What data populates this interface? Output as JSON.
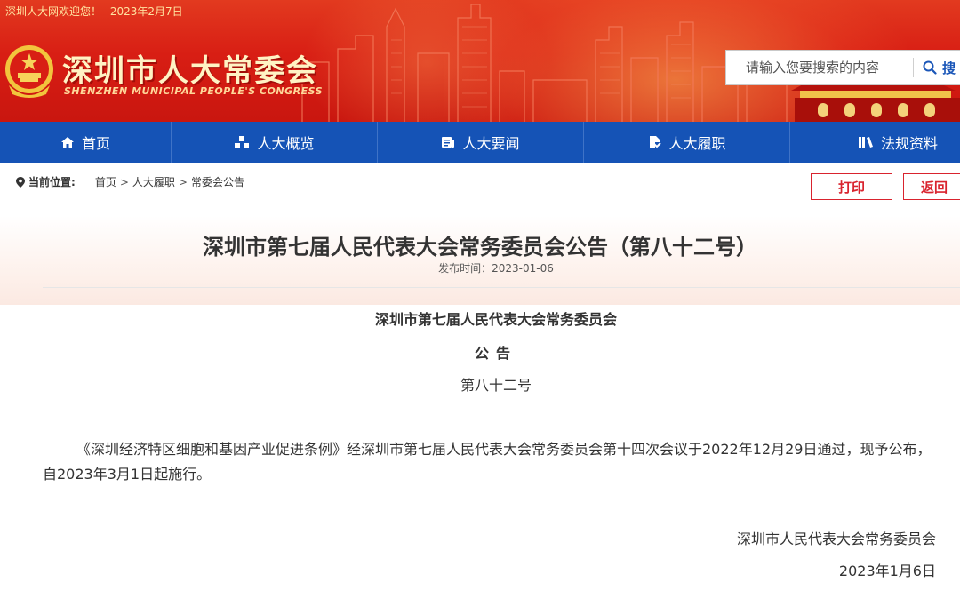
{
  "topbar": {
    "welcome": "深圳人大网欢迎您！",
    "date": "2023年2月7日"
  },
  "brand": {
    "title": "深圳市人大常委会",
    "subtitle": "SHENZHEN MUNICIPAL PEOPLE'S CONGRESS"
  },
  "search": {
    "placeholder": "请输入您要搜索的内容",
    "button_label": "搜"
  },
  "nav": {
    "items": [
      {
        "label": "首页",
        "icon": "home-icon"
      },
      {
        "label": "人大概览",
        "icon": "overview-icon"
      },
      {
        "label": "人大要闻",
        "icon": "news-icon"
      },
      {
        "label": "人大履职",
        "icon": "duty-icon"
      },
      {
        "label": "法规资料",
        "icon": "law-icon"
      }
    ]
  },
  "breadcrumb": {
    "label": "当前位置:",
    "items": [
      "首页",
      "人大履职",
      "常委会公告"
    ]
  },
  "actions": {
    "print": "打印",
    "back": "返回"
  },
  "article": {
    "title": "深圳市第七届人民代表大会常务委员会公告（第八十二号）",
    "publish_date": "发布时间：2023-01-06",
    "issuer": "深圳市第七届人民代表大会常务委员会",
    "heading": "公告",
    "number": "第八十二号",
    "body": "《深圳经济特区细胞和基因产业促进条例》经深圳市第七届人民代表大会常务委员会第十四次会议于2022年12月29日通过，现予公布，自2023年3月1日起施行。",
    "signature": "深圳市人民代表大会常务委员会",
    "sign_date": "2023年1月6日"
  },
  "colors": {
    "header_red": "#d81e14",
    "nav_blue": "#1553b6",
    "button_red": "#d9232e",
    "title_gold": "#fff3c4"
  }
}
